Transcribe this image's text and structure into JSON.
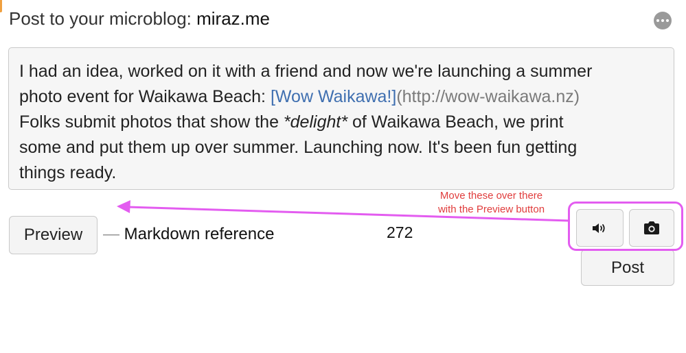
{
  "header": {
    "title_prefix": "Post to your microblog: ",
    "site": "miraz.me"
  },
  "post": {
    "text_line1": "I had an idea, worked on it with a friend and now we're launching a summer",
    "text_line2_before": "photo event for Waikawa Beach: ",
    "link_text": "[Wow Waikawa!]",
    "link_url": "(http://wow-waikawa.nz)",
    "text_line3_before": "Folks submit photos that show the ",
    "emphasis": "*delight*",
    "text_line3_after": " of Waikawa Beach, we print",
    "text_line4": "some and put them up over summer. Launching now. It's been fun getting",
    "text_line5": "things ready."
  },
  "toolbar": {
    "preview_label": "Preview",
    "markdown_dash": "—",
    "markdown_label": "Markdown reference",
    "char_count": "272",
    "post_label": "Post",
    "audio_icon": "speaker-icon",
    "photo_icon": "camera-icon"
  },
  "annotation": {
    "note_line1": "Move these over there",
    "note_line2": "with the Preview button",
    "color": "#e35cf0",
    "text_color": "#e03c3c"
  }
}
